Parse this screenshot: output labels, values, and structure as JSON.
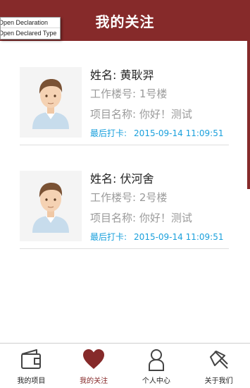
{
  "header": {
    "title": "我的关注"
  },
  "popup": {
    "items": [
      "Open Declaration",
      "Open Declared Type"
    ]
  },
  "cards": [
    {
      "name_label": "姓名:",
      "name": "黄耿羿",
      "building_label": "工作楼号:",
      "building": "1号楼",
      "project_label": "项目名称:",
      "project": "你好！测试",
      "clock_label": "最后打卡:",
      "clock_time": "2015-09-14 11:09:51"
    },
    {
      "name_label": "姓名:",
      "name": "伏河舍",
      "building_label": "工作楼号:",
      "building": "2号楼",
      "project_label": "项目名称:",
      "project": "你好！测试",
      "clock_label": "最后打卡:",
      "clock_time": "2015-09-14 11:09:51"
    }
  ],
  "nav": {
    "items": [
      {
        "label": "我的项目",
        "icon": "wallet-icon"
      },
      {
        "label": "我的关注",
        "icon": "heart-icon",
        "active": true
      },
      {
        "label": "个人中心",
        "icon": "person-icon"
      },
      {
        "label": "关于我们",
        "icon": "pin-icon"
      }
    ]
  },
  "colors": {
    "brand": "#862a2a",
    "accent": "#1aa0dc",
    "muted": "#9a9a9a"
  }
}
